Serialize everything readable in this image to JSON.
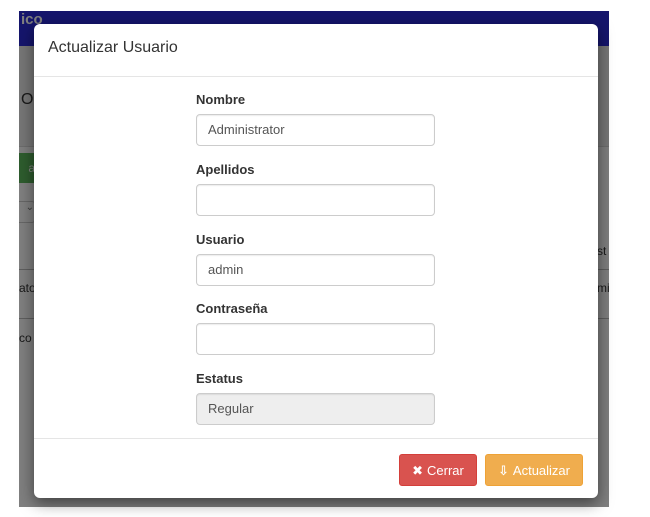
{
  "background": {
    "navbar_text": "ico",
    "subheader_text": "O",
    "add_button_fragment": "ar",
    "column_header_fragment": "st",
    "row1_left_fragment": "ato",
    "row1_right_fragment": "mi",
    "row2_left_fragment": "co"
  },
  "modal": {
    "title": "Actualizar Usuario",
    "fields": {
      "nombre": {
        "label": "Nombre",
        "value": "Administrator"
      },
      "apellidos": {
        "label": "Apellidos",
        "value": ""
      },
      "usuario": {
        "label": "Usuario",
        "value": "admin"
      },
      "contrasena": {
        "label": "Contraseña",
        "value": ""
      },
      "estatus": {
        "label": "Estatus",
        "value": "Regular"
      }
    },
    "buttons": {
      "close_icon": "✖",
      "close_label": "Cerrar",
      "update_icon": "⇩",
      "update_label": "Actualizar"
    }
  },
  "colors": {
    "navbar": "#2a2ad8",
    "close_button": "#d9534f",
    "update_button": "#f0ad4e",
    "add_button": "#5cb85c"
  },
  "icons": {
    "close": "close-icon",
    "update": "download-icon"
  }
}
